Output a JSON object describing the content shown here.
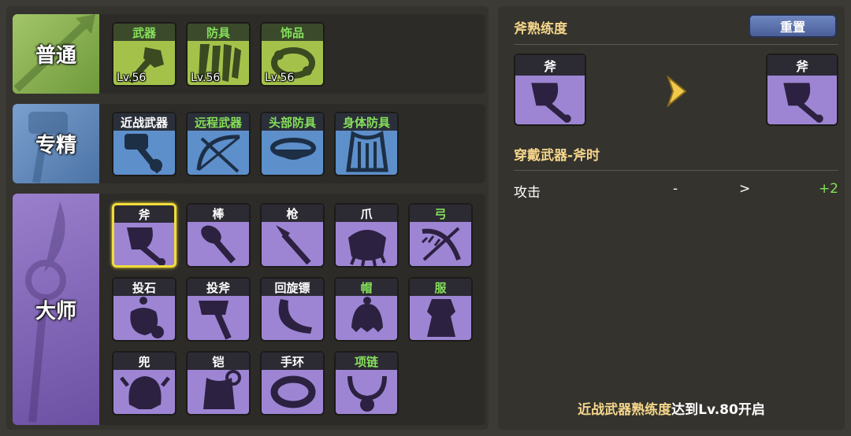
{
  "sections": {
    "normal": {
      "label": "普通",
      "items": [
        {
          "title": "武器",
          "level": "Lv.56",
          "icon": "weapon-icon"
        },
        {
          "title": "防具",
          "level": "Lv.56",
          "icon": "armor-icon"
        },
        {
          "title": "饰品",
          "level": "Lv.56",
          "icon": "accessory-icon"
        }
      ]
    },
    "specialty": {
      "label": "专精",
      "items": [
        {
          "title": "近战武器",
          "icon": "melee-weapon-icon"
        },
        {
          "title": "远程武器",
          "icon": "ranged-weapon-icon"
        },
        {
          "title": "头部防具",
          "icon": "head-armor-icon"
        },
        {
          "title": "身体防具",
          "icon": "body-armor-icon"
        }
      ]
    },
    "master": {
      "label": "大师",
      "items": [
        {
          "title": "斧",
          "icon": "axe-icon",
          "selected": true
        },
        {
          "title": "棒",
          "icon": "club-icon"
        },
        {
          "title": "枪",
          "icon": "spear-icon"
        },
        {
          "title": "爪",
          "icon": "claw-icon"
        },
        {
          "title": "弓",
          "icon": "bow-icon"
        },
        {
          "title": "投石",
          "icon": "sling-stone-icon"
        },
        {
          "title": "投斧",
          "icon": "throwing-axe-icon"
        },
        {
          "title": "回旋镖",
          "icon": "boomerang-icon"
        },
        {
          "title": "帽",
          "icon": "hat-icon"
        },
        {
          "title": "服",
          "icon": "clothes-icon"
        },
        {
          "title": "兜",
          "icon": "helmet-icon"
        },
        {
          "title": "铠",
          "icon": "mail-armor-icon"
        },
        {
          "title": "手环",
          "icon": "bracelet-icon"
        },
        {
          "title": "项链",
          "icon": "necklace-icon"
        }
      ]
    }
  },
  "detail": {
    "title": "斧熟练度",
    "reset_label": "重置",
    "from_card": {
      "title": "斧",
      "icon": "axe-icon"
    },
    "to_card": {
      "title": "斧",
      "icon": "axe-icon"
    },
    "arrow_icon": "arrow-right-icon",
    "subtitle": "穿戴武器-斧时",
    "stat": {
      "name": "攻击",
      "from": "-",
      "sep": ">",
      "to": "+2"
    },
    "unlock_highlight": "近战武器熟练度",
    "unlock_rest": "达到Lv.80开启"
  },
  "colors": {
    "gold_text": "#f4d58a",
    "green_text": "#86e05a",
    "normal_bg": "#a4c24a",
    "specialty_bg": "#5d8fcb",
    "master_bg": "#9d85d4",
    "selected_border": "#f1dc3a"
  }
}
